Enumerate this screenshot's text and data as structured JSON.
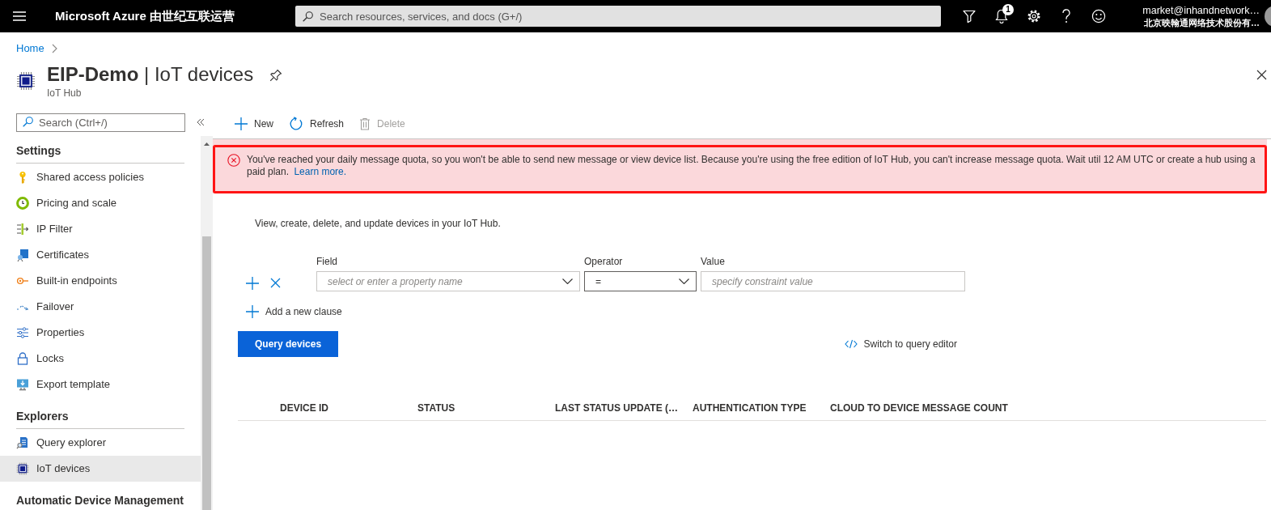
{
  "top_bar": {
    "title": "Microsoft Azure 由世纪互联运营",
    "search": {
      "placeholder": "Search resources, services, and docs (G+/)"
    },
    "notifications": {
      "badge": "1"
    },
    "account": {
      "email": "market@inhandnetwork…",
      "organization": "北京映翰通网络技术股份有…"
    }
  },
  "breadcrumb": [
    {
      "label": "Home"
    }
  ],
  "header": {
    "title": "**EIP-Demo** | IoT devices",
    "subtitle": "IoT Hub"
  },
  "sidebar": {
    "search": {
      "placeholder": "Search (Ctrl+/)"
    },
    "groups": [
      {
        "heading": "Settings",
        "items": [
          {
            "label": "Shared access policies",
            "selected": false
          },
          {
            "label": "Pricing and scale",
            "selected": false
          },
          {
            "label": "IP Filter",
            "selected": false
          },
          {
            "label": "Certificates",
            "selected": false
          },
          {
            "label": "Built-in endpoints",
            "selected": false
          },
          {
            "label": "Failover",
            "selected": false
          },
          {
            "label": "Properties",
            "selected": false
          },
          {
            "label": "Locks",
            "selected": false
          },
          {
            "label": "Export template",
            "selected": false
          }
        ]
      },
      {
        "heading": "Explorers",
        "items": [
          {
            "label": "Query explorer",
            "selected": false
          },
          {
            "label": "IoT devices",
            "selected": true
          }
        ]
      },
      {
        "heading": "Automatic Device Management"
      }
    ]
  },
  "toolbar": [
    {
      "label": "New",
      "disabled": false
    },
    {
      "label": "Refresh",
      "disabled": false
    },
    {
      "label": "Delete",
      "disabled": true
    }
  ],
  "alert": {
    "message": "You've reached your daily message quota, so you won't be able to send new message or view device list. Because you're using the free edition of IoT Hub, you can't increase message quota. Wait util 12 AM UTC or create a hub using a paid plan.",
    "link": "Learn more."
  },
  "description": "View, create, delete, and update devices in your IoT Hub.",
  "filter": {
    "fields": [
      {
        "label": "Field",
        "kind": "select",
        "placeholder": "select or enter a property name",
        "focused": false
      },
      {
        "label": "Operator",
        "kind": "select",
        "value": "=",
        "focused": true
      },
      {
        "label": "Value",
        "kind": "input",
        "placeholder": "specify constraint value",
        "focused": false
      }
    ],
    "add_clause": "Add a new clause",
    "query_button": "Query devices",
    "switch_link": "Switch to query editor"
  },
  "table": {
    "columns": [
      "DEVICE ID",
      "STATUS",
      "LAST STATUS UPDATE (…",
      "AUTHENTICATION TYPE",
      "CLOUD TO DEVICE MESSAGE COUNT"
    ]
  }
}
